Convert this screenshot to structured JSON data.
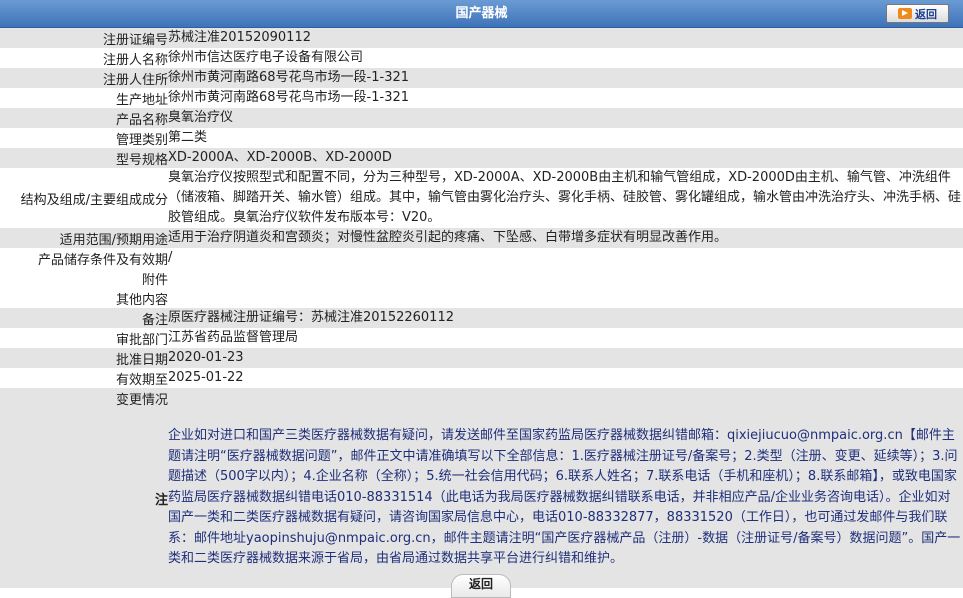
{
  "header": {
    "title": "国产器械",
    "back_label": "返回"
  },
  "rows": [
    {
      "label": "注册证编号",
      "value": "苏械注准20152090112"
    },
    {
      "label": "注册人名称",
      "value": "徐州市信达医疗电子设备有限公司"
    },
    {
      "label": "注册人住所",
      "value": "徐州市黄河南路68号花鸟市场一段-1-321"
    },
    {
      "label": "生产地址",
      "value": "徐州市黄河南路68号花鸟市场一段-1-321"
    },
    {
      "label": "产品名称",
      "value": "臭氧治疗仪"
    },
    {
      "label": "管理类别",
      "value": "第二类"
    },
    {
      "label": "型号规格",
      "value": "XD-2000A、XD-2000B、XD-2000D"
    },
    {
      "label": "结构及组成/主要组成成分",
      "value": "臭氧治疗仪按照型式和配置不同，分为三种型号，XD-2000A、XD-2000B由主机和输气管组成，XD-2000D由主机、输气管、冲洗组件（储液箱、脚踏开关、输水管）组成。其中，输气管由雾化治疗头、雾化手柄、硅胶管、雾化罐组成，输水管由冲洗治疗头、冲洗手柄、硅胶管组成。臭氧治疗仪软件发布版本号：V20。"
    },
    {
      "label": "适用范围/预期用途",
      "value": "适用于治疗阴道炎和宫颈炎；对慢性盆腔炎引起的疼痛、下坠感、白带增多症状有明显改善作用。"
    },
    {
      "label": "产品储存条件及有效期",
      "value": "/"
    },
    {
      "label": "附件",
      "value": ""
    },
    {
      "label": "其他内容",
      "value": ""
    },
    {
      "label": "备注",
      "value": "原医疗器械注册证编号：苏械注准20152260112"
    },
    {
      "label": "审批部门",
      "value": "江苏省药品监督管理局"
    },
    {
      "label": "批准日期",
      "value": "2020-01-23"
    },
    {
      "label": "有效期至",
      "value": "2025-01-22"
    },
    {
      "label": "变更情况",
      "value": ""
    }
  ],
  "note": {
    "label": "注",
    "text": "企业如对进口和国产三类医疗器械数据有疑问，请发送邮件至国家药监局医疗器械数据纠错邮箱：qixiejiucuo@nmpaic.org.cn【邮件主题请注明“医疗器械数据问题”，邮件正文中请准确填写以下全部信息：1.医疗器械注册证号/备案号；2.类型（注册、变更、延续等）；3.问题描述（500字以内）；4.企业名称（全称）；5.统一社会信用代码；6.联系人姓名；7.联系电话（手机和座机）；8.联系邮箱】，或致电国家药监局医疗器械数据纠错电话010-88331514（此电话为我局医疗器械数据纠错联系电话，并非相应产品/企业业务咨询电话）。企业如对国产一类和二类医疗器械数据有疑问，请咨询国家局信息中心，电话010-88332877，88331520（工作日），也可通过发邮件与我们联系：邮件地址yaopinshuju@nmpaic.org.cn，邮件主题请注明“国产医疗器械产品（注册）-数据（注册证号/备案号）数据问题”。国产一类和二类医疗器械数据来源于省局，由省局通过数据共享平台进行纠错和维护。"
  },
  "footer": {
    "back_label": "返回"
  }
}
